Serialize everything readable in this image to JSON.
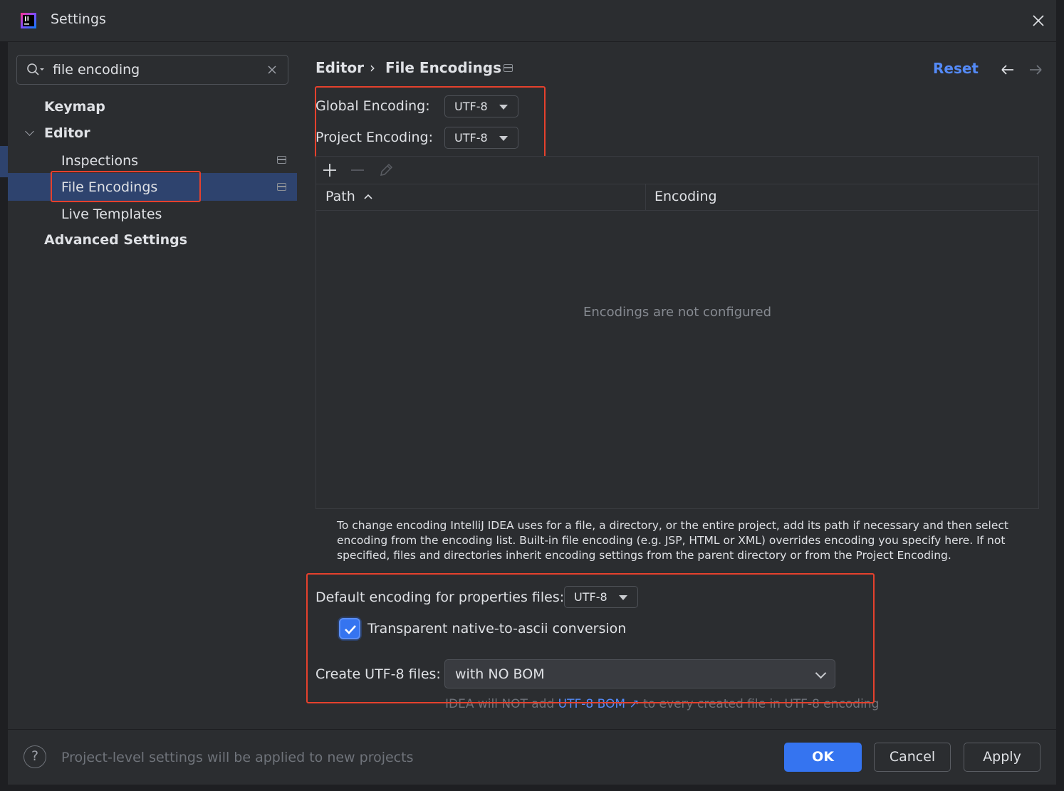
{
  "window": {
    "title": "Settings"
  },
  "search": {
    "value": "file encoding",
    "placeholder": ""
  },
  "sidebar": {
    "items": [
      {
        "label": "Keymap"
      },
      {
        "label": "Editor"
      },
      {
        "label": "Inspections"
      },
      {
        "label": "File Encodings"
      },
      {
        "label": "Live Templates"
      },
      {
        "label": "Advanced Settings"
      }
    ]
  },
  "header": {
    "breadcrumb_parent": "Editor",
    "breadcrumb_sep": "›",
    "breadcrumb_current": "File Encodings",
    "reset_label": "Reset"
  },
  "encodings": {
    "global_label": "Global Encoding:",
    "global_value": "UTF-8",
    "project_label": "Project Encoding:",
    "project_value": "UTF-8"
  },
  "table": {
    "columns": [
      "Path",
      "Encoding"
    ],
    "empty_text": "Encodings are not configured"
  },
  "help_text": "To change encoding IntelliJ IDEA uses for a file, a directory, or the entire project, add its path if necessary and then select encoding from the encoding list. Built-in file encoding (e.g. JSP, HTML or XML) overrides encoding you specify here. If not specified, files and directories inherit encoding settings from the parent directory or from the Project Encoding.",
  "properties": {
    "default_label": "Default encoding for properties files:",
    "default_value": "UTF-8",
    "transparent_label": "Transparent native-to-ascii conversion",
    "transparent_checked": true,
    "create_label": "Create UTF-8 files:",
    "create_value": "with NO BOM",
    "hint_prefix": "IDEA will NOT add ",
    "hint_link": "UTF-8 BOM ↗",
    "hint_suffix": " to every created file in UTF-8 encoding"
  },
  "footer": {
    "help_glyph": "?",
    "message": "Project-level settings will be applied to new projects",
    "ok_label": "OK",
    "cancel_label": "Cancel",
    "apply_label": "Apply"
  },
  "colors": {
    "accent": "#3574f0",
    "link": "#548af7",
    "highlight_box": "#e5412d",
    "selection": "#2e436e"
  }
}
